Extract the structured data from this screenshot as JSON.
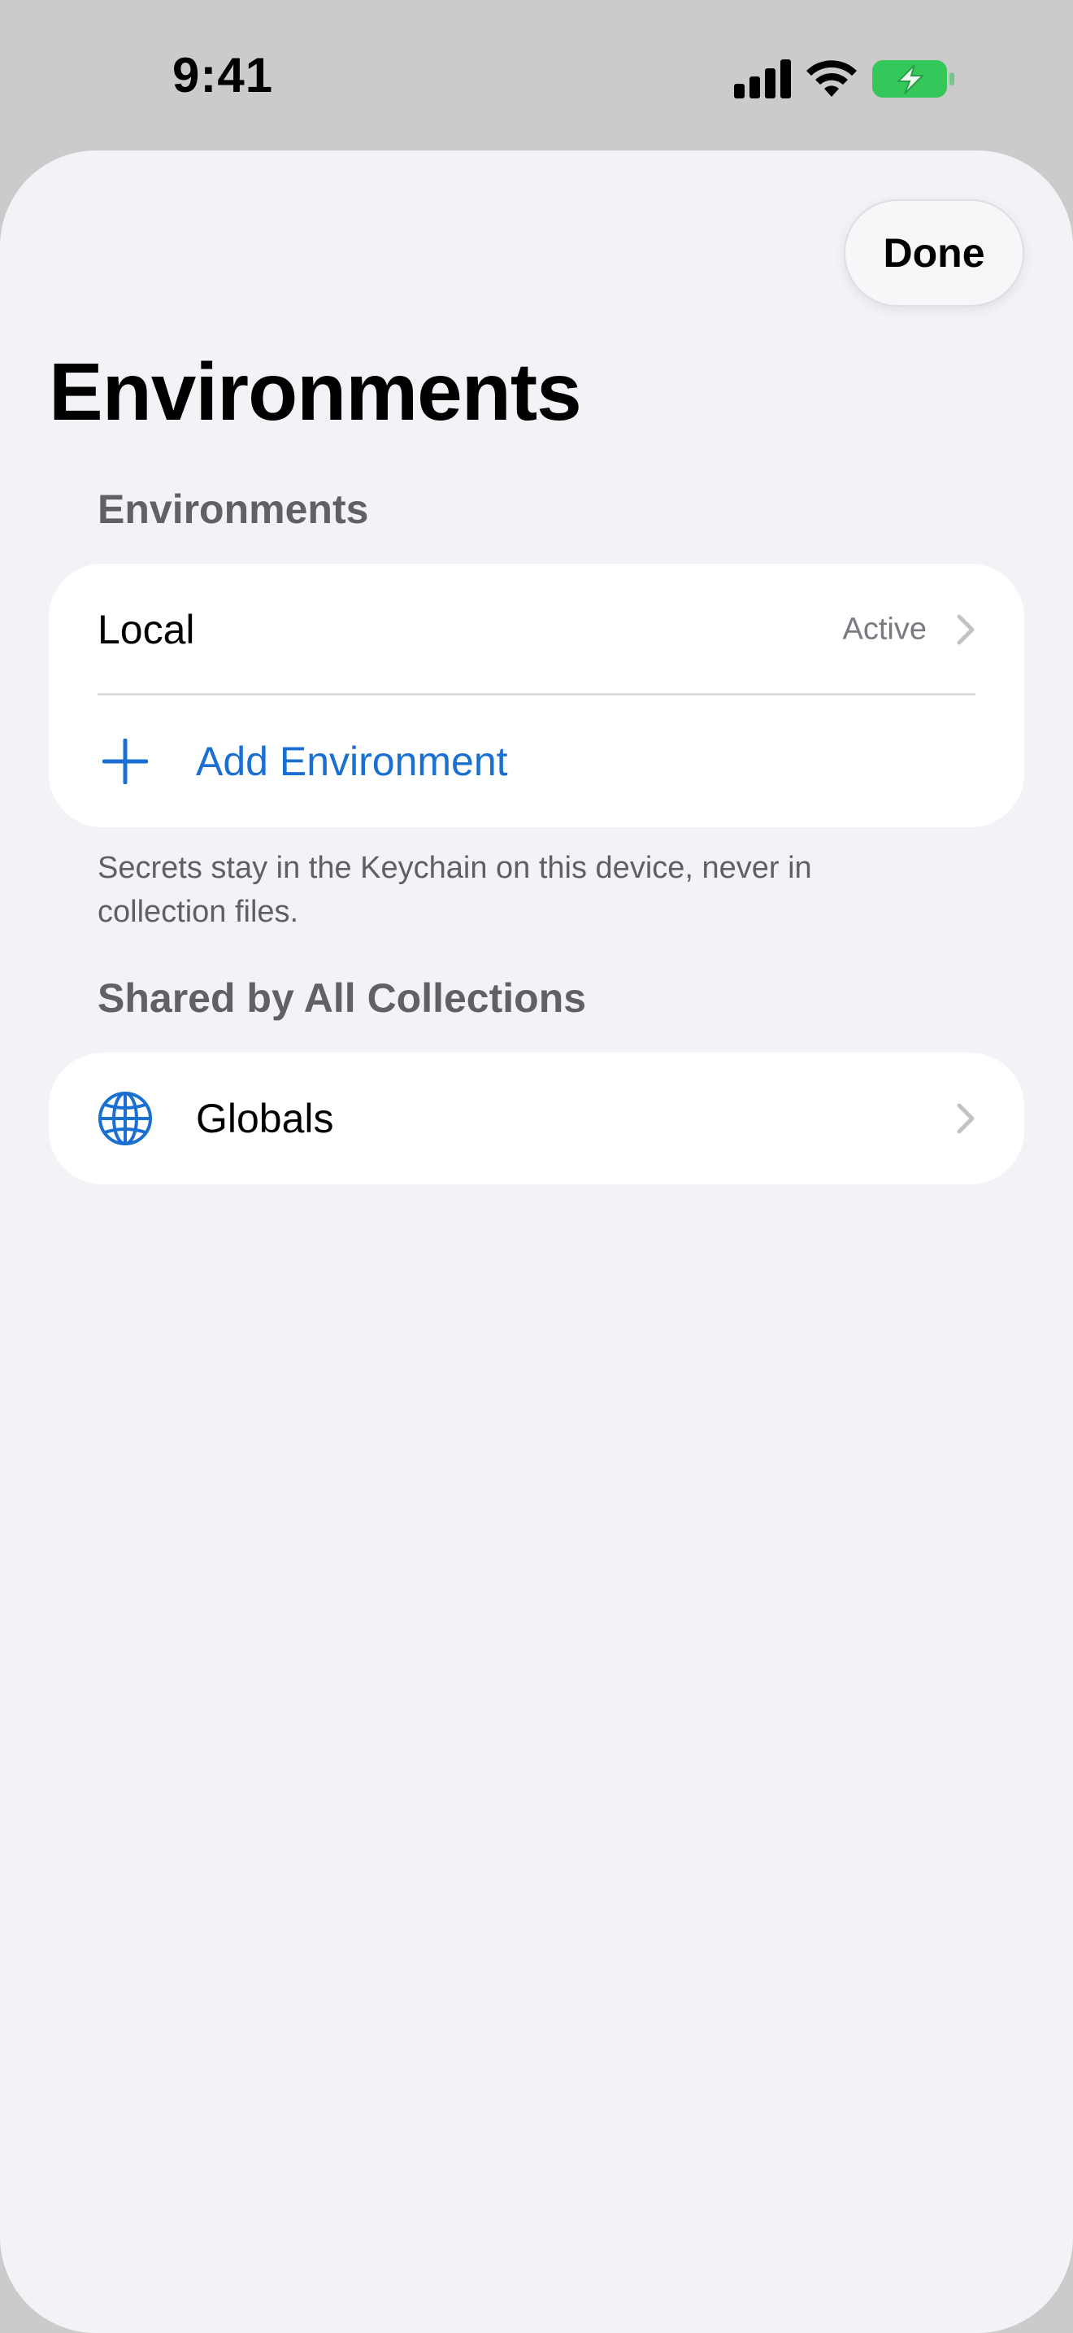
{
  "status_bar": {
    "time": "9:41",
    "icons": [
      "cellular-signal-icon",
      "wifi-icon",
      "battery-charging-icon"
    ],
    "battery_color": "#34c759"
  },
  "nav": {
    "done_label": "Done"
  },
  "page": {
    "title": "Environments"
  },
  "sections": {
    "environments": {
      "header": "Environments",
      "rows": [
        {
          "label": "Local",
          "detail": "Active"
        }
      ],
      "add_label": "Add Environment",
      "footer": "Secrets stay in the Keychain on this device, never in collection files."
    },
    "shared": {
      "header": "Shared by All Collections",
      "rows": [
        {
          "label": "Globals",
          "icon": "globe-icon"
        }
      ]
    }
  },
  "colors": {
    "accent": "#1a6fd0",
    "background": "#f2f2f7",
    "secondary_text": "#606066"
  }
}
